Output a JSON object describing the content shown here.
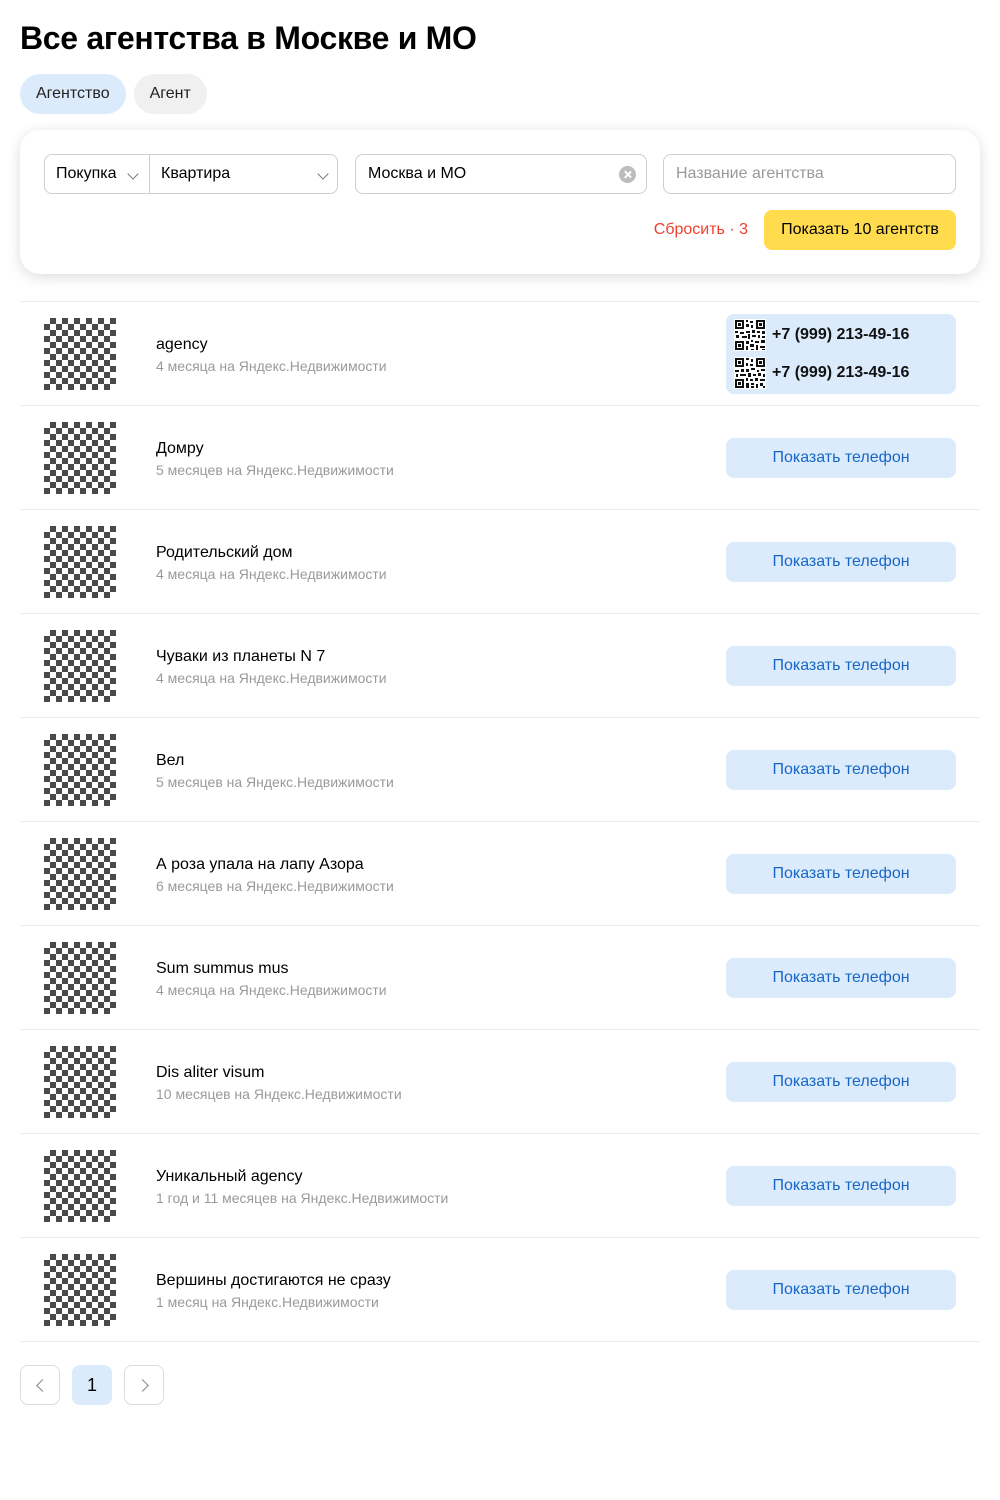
{
  "header": {
    "title": "Все агентства в Москве и МО"
  },
  "type_tabs": [
    {
      "label": "Агентство",
      "active": true
    },
    {
      "label": "Агент",
      "active": false
    }
  ],
  "filters": {
    "deal_type": "Покупка",
    "category": "Квартира",
    "region": "Москва и МО",
    "name_placeholder": "Название агентства",
    "reset_label": "Сбросить · 3",
    "show_label": "Показать 10 агентств"
  },
  "agencies": [
    {
      "name": "agency",
      "meta": "4 месяца на Яндекс.Недвижимости",
      "phones": [
        "+7 (999) 213-49-16",
        "+7 (999) 213-49-16"
      ]
    },
    {
      "name": "Домру",
      "meta": "5 месяцев на Яндекс.Недвижимости",
      "button": "Показать телефон"
    },
    {
      "name": "Родительский дом",
      "meta": "4 месяца на Яндекс.Недвижимости",
      "button": "Показать телефон"
    },
    {
      "name": "Чуваки из планеты N 7",
      "meta": "4 месяца на Яндекс.Недвижимости",
      "button": "Показать телефон"
    },
    {
      "name": "Вел",
      "meta": "5 месяцев на Яндекс.Недвижимости",
      "button": "Показать телефон"
    },
    {
      "name": "А роза упала на лапу Азора",
      "meta": "6 месяцев на Яндекс.Недвижимости",
      "button": "Показать телефон"
    },
    {
      "name": "Sum summus mus",
      "meta": "4 месяца на Яндекс.Недвижимости",
      "button": "Показать телефон"
    },
    {
      "name": "Dis aliter visum",
      "meta": "10 месяцев на Яндекс.Недвижимости",
      "button": "Показать телефон"
    },
    {
      "name": "Уникальный agency",
      "meta": "1 год и 11 месяцев на Яндекс.Недвижимости",
      "button": "Показать телефон"
    },
    {
      "name": "Вершины достигаются не сразу",
      "meta": "1 месяц на Яндекс.Недвижимости",
      "button": "Показать телефон"
    }
  ],
  "pagination": {
    "current_page": "1"
  },
  "icons": {
    "select_arrow": "chevron-down-icon",
    "clear": "clear-icon",
    "phone_qr": "qr-code-icon",
    "prev": "chevron-left-icon",
    "next": "chevron-right-icon"
  },
  "colors": {
    "accent_button": "#ffdb4d",
    "phone_button_bg": "#dcebfb",
    "phone_button_text": "#1566c7",
    "reset_text": "#f04030"
  }
}
